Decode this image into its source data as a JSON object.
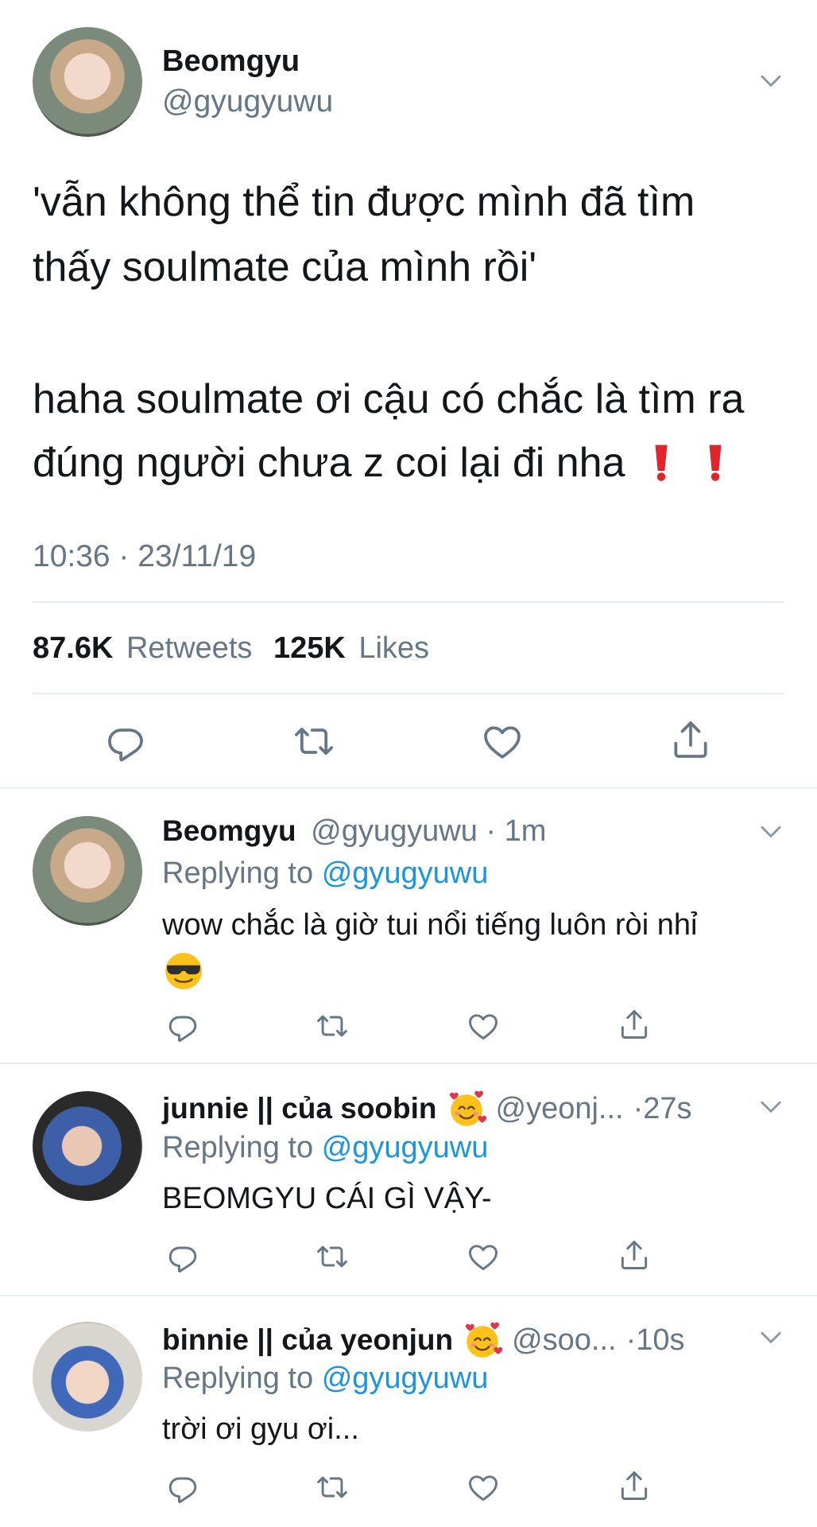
{
  "tweet": {
    "author": {
      "name": "Beomgyu",
      "handle": "@gyugyuwu"
    },
    "text_line1": "'vẫn không thể tin được mình đã tìm",
    "text_line2": "thấy soulmate của mình rồi'",
    "text_line3": "haha soulmate ơi cậu có chắc là tìm ra",
    "text_line4": "đúng người chưa z coi lại đi nha",
    "timestamp": "10:36 · 23/11/19",
    "retweets_count": "87.6K",
    "retweets_label": "Retweets",
    "likes_count": "125K",
    "likes_label": "Likes"
  },
  "replies": [
    {
      "name": "Beomgyu",
      "handle": "@gyugyuwu",
      "sep": "·",
      "time": "1m",
      "replying_label": "Replying to",
      "replying_handle": "@gyugyuwu",
      "text": "wow chắc là giờ tui nổi tiếng luôn ròi nhỉ"
    },
    {
      "name": "junnie || của soobin",
      "handle": "@yeonj...",
      "sep": "·",
      "time": "27s",
      "replying_label": "Replying to",
      "replying_handle": "@gyugyuwu",
      "text": "BEOMGYU CÁI GÌ VẬY-"
    },
    {
      "name": "binnie || của yeonjun",
      "handle": "@soo...",
      "sep": "·",
      "time": "10s",
      "replying_label": "Replying to",
      "replying_handle": "@gyugyuwu",
      "text": "trời ơi gyu ơi..."
    }
  ],
  "icons": {
    "reply": "reply-icon",
    "retweet": "retweet-icon",
    "like": "heart-icon",
    "share": "share-icon",
    "more": "chevron-down-icon",
    "exclamation": "red-exclamation-emoji",
    "sunglasses": "smiling-face-with-sunglasses-emoji",
    "hearts_face": "smiling-face-with-hearts-emoji"
  },
  "colors": {
    "text": "#14171a",
    "muted": "#657786",
    "link": "#1b95e0",
    "divider": "#e6ecf0",
    "exclamation": "#e0262b"
  }
}
